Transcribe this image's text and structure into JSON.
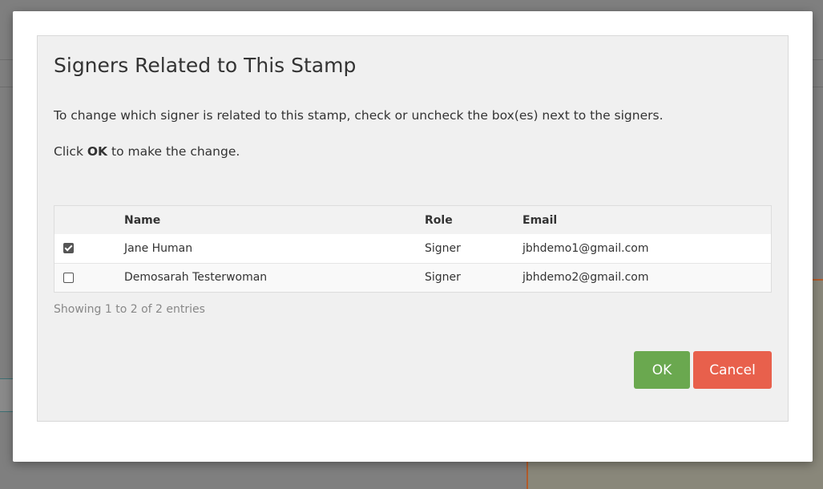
{
  "dialog": {
    "title": "Signers Related to This Stamp",
    "instruction": "To change which signer is related to this stamp, check or uncheck the box(es) next to the signers.",
    "click_prefix": "Click ",
    "click_bold": "OK",
    "click_suffix": " to make the change.",
    "columns": {
      "name": "Name",
      "role": "Role",
      "email": "Email"
    },
    "rows": [
      {
        "checked": true,
        "name": "Jane Human",
        "role": "Signer",
        "email": "jbhdemo1@gmail.com"
      },
      {
        "checked": false,
        "name": "Demosarah Testerwoman",
        "role": "Signer",
        "email": "jbhdemo2@gmail.com"
      }
    ],
    "info": "Showing 1 to 2 of 2 entries",
    "ok_label": "OK",
    "cancel_label": "Cancel",
    "colors": {
      "ok": "#6aa84f",
      "cancel": "#e8604c"
    }
  }
}
